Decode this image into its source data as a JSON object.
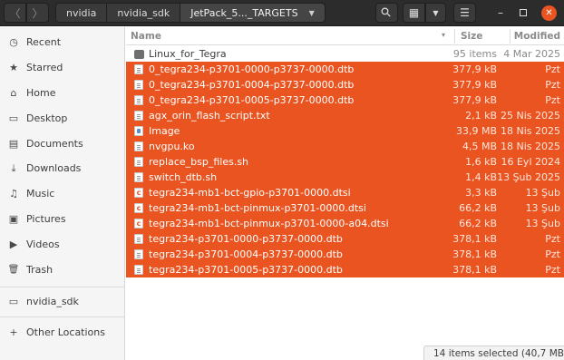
{
  "breadcrumbs": [
    "nvidia",
    "nvidia_sdk",
    "JetPack_5..._TARGETS"
  ],
  "header": {
    "back_glyph": "〈",
    "forward_glyph": "〉",
    "search_glyph": "⚲",
    "view_glyph": "▦",
    "dropdown_glyph": "▼",
    "menu_glyph": "☰",
    "minimize_glyph": "–",
    "close_glyph": "✕",
    "accent_color": "#e95420"
  },
  "sidebar": {
    "items": [
      {
        "label": "Recent",
        "icon": "clock-icon",
        "glyph": "◷"
      },
      {
        "label": "Starred",
        "icon": "star-icon",
        "glyph": "★"
      },
      {
        "label": "Home",
        "icon": "home-icon",
        "glyph": "⌂"
      },
      {
        "label": "Desktop",
        "icon": "desktop-icon",
        "glyph": "▭"
      },
      {
        "label": "Documents",
        "icon": "documents-icon",
        "glyph": "▤"
      },
      {
        "label": "Downloads",
        "icon": "downloads-icon",
        "glyph": "⤓"
      },
      {
        "label": "Music",
        "icon": "music-icon",
        "glyph": "♫"
      },
      {
        "label": "Pictures",
        "icon": "pictures-icon",
        "glyph": "▣"
      },
      {
        "label": "Videos",
        "icon": "videos-icon",
        "glyph": "▶"
      },
      {
        "label": "Trash",
        "icon": "trash-icon",
        "glyph": "🗑"
      }
    ],
    "bookmarks": [
      {
        "label": "nvidia_sdk",
        "icon": "folder-icon",
        "glyph": "▭"
      }
    ],
    "other_locations": {
      "label": "Other Locations",
      "icon": "plus-icon",
      "glyph": "+"
    }
  },
  "columns": {
    "name": "Name",
    "size": "Size",
    "modified": "Modified",
    "sort_glyph": "▾"
  },
  "files": [
    {
      "name": "Linux_for_Tegra",
      "size": "95 items",
      "modified": "4 Mar 2025",
      "type": "folder",
      "selected": false
    },
    {
      "name": "0_tegra234-p3701-0000-p3737-0000.dtb",
      "size": "377,9 kB",
      "modified": "Pzt",
      "type": "file",
      "selected": true
    },
    {
      "name": "0_tegra234-p3701-0004-p3737-0000.dtb",
      "size": "377,9 kB",
      "modified": "Pzt",
      "type": "file",
      "selected": true
    },
    {
      "name": "0_tegra234-p3701-0005-p3737-0000.dtb",
      "size": "377,9 kB",
      "modified": "Pzt",
      "type": "file",
      "selected": true
    },
    {
      "name": "agx_orin_flash_script.txt",
      "size": "2,1 kB",
      "modified": "25 Nis 2025",
      "type": "file",
      "selected": true
    },
    {
      "name": "Image",
      "size": "33,9 MB",
      "modified": "18 Nis 2025",
      "type": "img",
      "selected": true
    },
    {
      "name": "nvgpu.ko",
      "size": "4,5 MB",
      "modified": "18 Nis 2025",
      "type": "file",
      "selected": true
    },
    {
      "name": "replace_bsp_files.sh",
      "size": "1,6 kB",
      "modified": "16 Eyl 2024",
      "type": "file",
      "selected": true
    },
    {
      "name": "switch_dtb.sh",
      "size": "1,4 kB",
      "modified": "13 Şub 2025",
      "type": "file",
      "selected": true
    },
    {
      "name": "tegra234-mb1-bct-gpio-p3701-0000.dtsi",
      "size": "3,3 kB",
      "modified": "13 Şub",
      "type": "src",
      "selected": true
    },
    {
      "name": "tegra234-mb1-bct-pinmux-p3701-0000.dtsi",
      "size": "66,2 kB",
      "modified": "13 Şub",
      "type": "src",
      "selected": true
    },
    {
      "name": "tegra234-mb1-bct-pinmux-p3701-0000-a04.dtsi",
      "size": "66,2 kB",
      "modified": "13 Şub",
      "type": "src",
      "selected": true
    },
    {
      "name": "tegra234-p3701-0000-p3737-0000.dtb",
      "size": "378,1 kB",
      "modified": "Pzt",
      "type": "file",
      "selected": true
    },
    {
      "name": "tegra234-p3701-0004-p3737-0000.dtb",
      "size": "378,1 kB",
      "modified": "Pzt",
      "type": "file",
      "selected": true
    },
    {
      "name": "tegra234-p3701-0005-p3737-0000.dtb",
      "size": "378,1 kB",
      "modified": "Pzt",
      "type": "file",
      "selected": true
    }
  ],
  "status": "14 items selected (40,7 MB)"
}
